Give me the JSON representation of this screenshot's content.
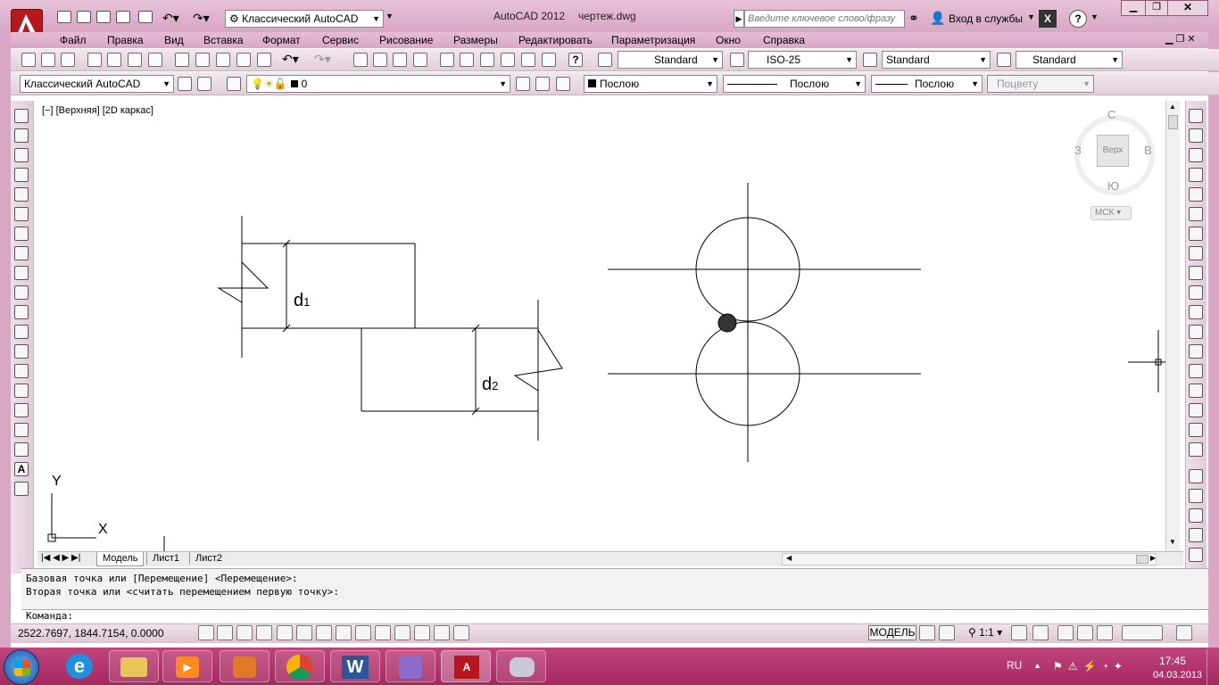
{
  "window": {
    "app_title": "AutoCAD 2012",
    "doc_title": "чертеж.dwg",
    "workspace": "Классический AutoCAD",
    "search_placeholder": "Введите ключевое слово/фразу",
    "signin": "Вход в службы"
  },
  "menu": [
    "Файл",
    "Правка",
    "Вид",
    "Вставка",
    "Формат",
    "Сервис",
    "Рисование",
    "Размеры",
    "Редактировать",
    "Параметризация",
    "Окно",
    "Справка"
  ],
  "styles": {
    "text_style": "Standard",
    "dim_style": "ISO-25",
    "table_style": "Standard",
    "mleader_style": "Standard"
  },
  "layers": {
    "workspace": "Классический AutoCAD",
    "layer": "0",
    "color": "Послою",
    "linetype": "Послою",
    "lineweight": "Послою",
    "plotstyle": "Поцвету"
  },
  "viewport": {
    "label": "[−] [Верхняя] [2D каркас]"
  },
  "viewcube": {
    "north": "С",
    "south": "Ю",
    "west": "З",
    "east": "В",
    "face": "Верх",
    "ucs": "МСК"
  },
  "drawing": {
    "d1_base": "d",
    "d1_sub": "1",
    "d2_base": "d",
    "d2_sub": "2",
    "ucs_y": "Y",
    "ucs_x": "X"
  },
  "tabs": [
    "Модель",
    "Лист1",
    "Лист2"
  ],
  "command": {
    "line1": "Базовая точка или [Перемещение] <Перемещение>:",
    "line2": "Вторая точка или <считать перемещением первую точку>:",
    "prompt": "Команда:"
  },
  "status": {
    "coords": "2522.7697, 1844.7154, 0.0000",
    "model": "МОДЕЛЬ",
    "scale": "1:1"
  },
  "tray": {
    "lang": "RU",
    "time": "17:45",
    "date": "04.03.2013"
  }
}
